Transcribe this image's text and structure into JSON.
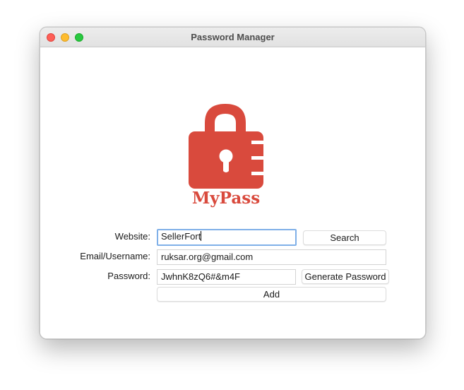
{
  "window": {
    "title": "Password Manager"
  },
  "logo": {
    "text": "MyPass",
    "color": "#d94a3d"
  },
  "form": {
    "website_label": "Website:",
    "website_value": "SellerFort",
    "email_label": "Email/Username:",
    "email_value": "ruksar.org@gmail.com",
    "password_label": "Password:",
    "password_value": "JwhnK8zQ6#&m4F"
  },
  "buttons": {
    "search": "Search",
    "generate": "Generate Password",
    "add": "Add"
  },
  "colors": {
    "focus_ring": "#7fb0e8",
    "close": "#fe5f57",
    "minimize": "#febc2e",
    "maximize": "#28c840"
  }
}
